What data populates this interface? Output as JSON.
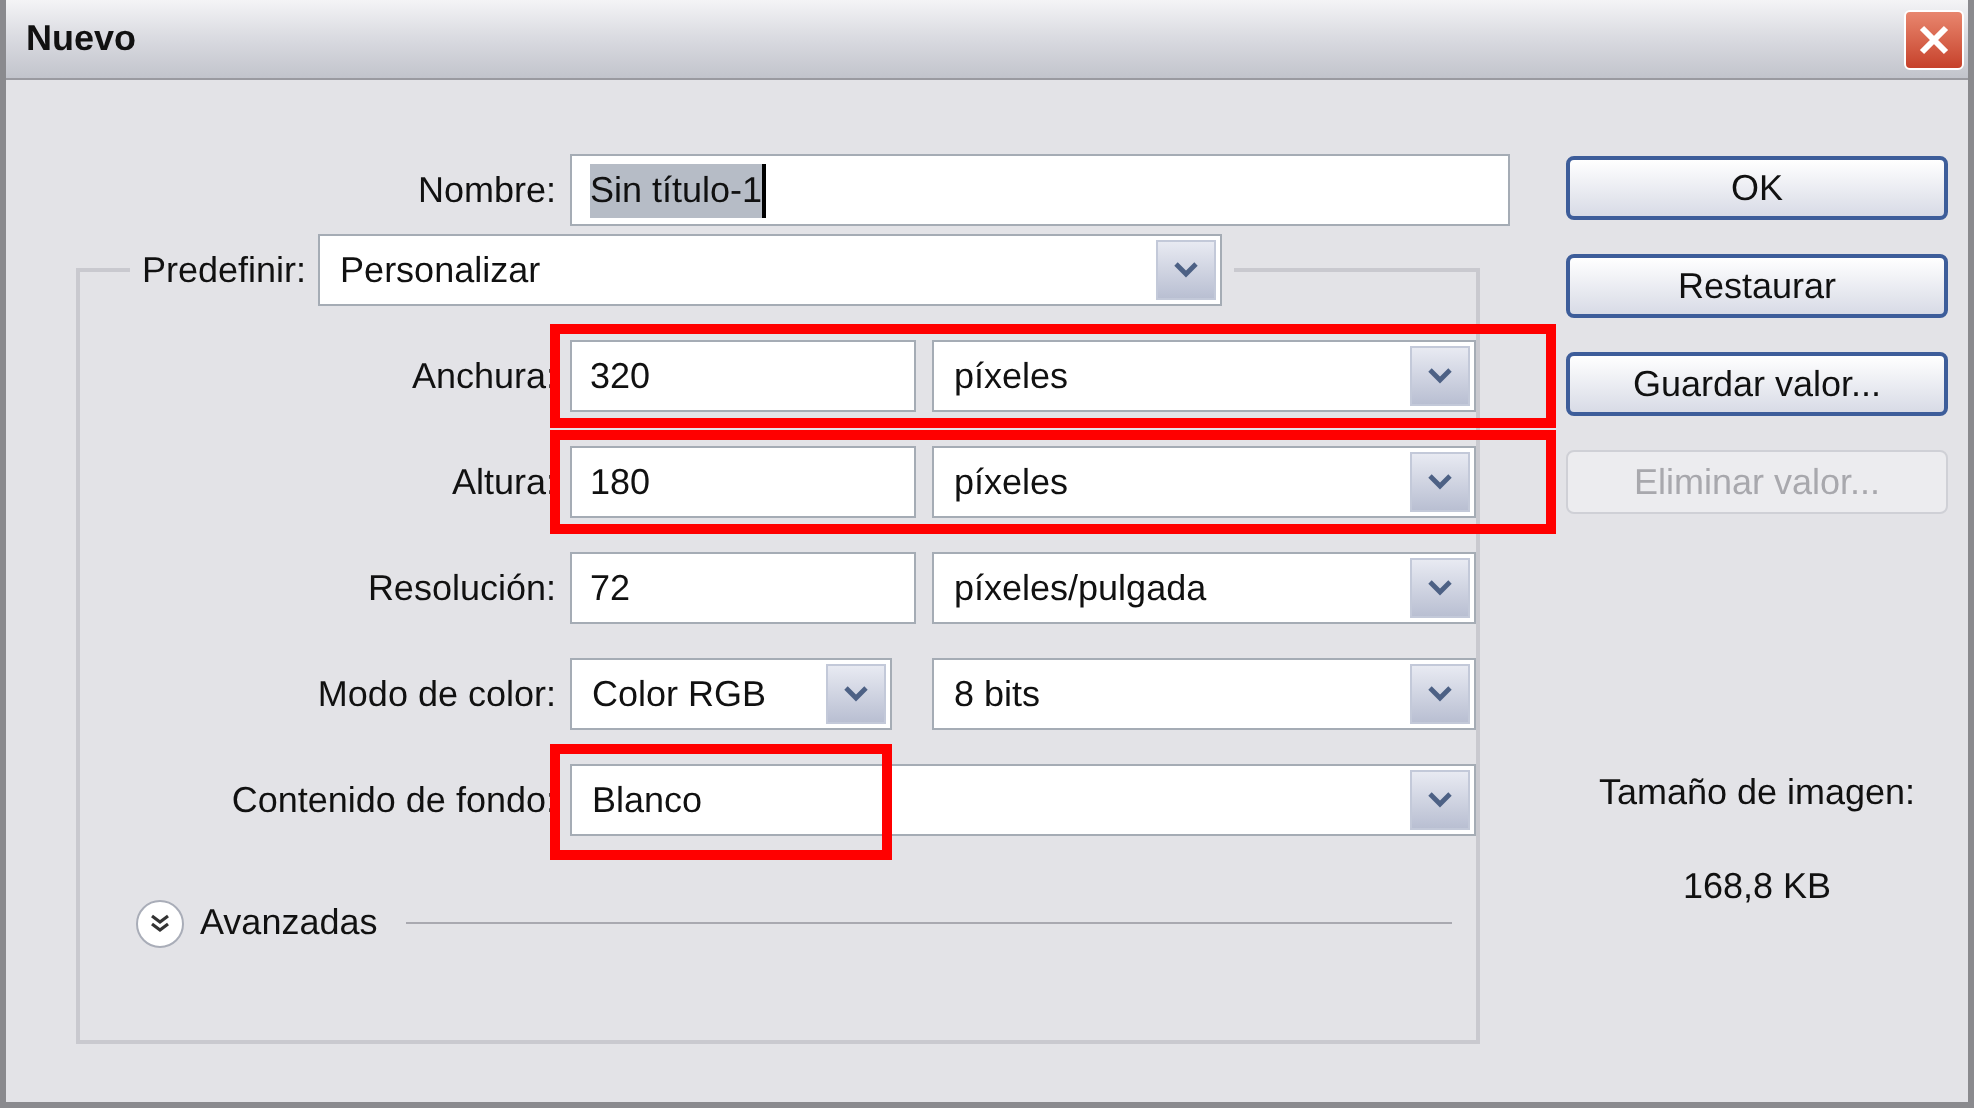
{
  "window": {
    "title": "Nuevo"
  },
  "name_field": {
    "label": "Nombre:",
    "value": "Sin título-1",
    "text_selected": true
  },
  "preset": {
    "label": "Predefinir:",
    "value": "Personalizar"
  },
  "rows": [
    {
      "kind": "value_unit",
      "label": "Anchura:",
      "value": "320",
      "unit": "píxeles",
      "highlighted": true
    },
    {
      "kind": "value_unit",
      "label": "Altura:",
      "value": "180",
      "unit": "píxeles",
      "highlighted": true
    },
    {
      "kind": "value_unit",
      "label": "Resolución:",
      "value": "72",
      "unit": "píxeles/pulgada"
    },
    {
      "kind": "two_selects",
      "label": "Modo de color:",
      "value": "Color RGB",
      "unit": "8 bits"
    },
    {
      "kind": "select",
      "label": "Contenido de fondo:",
      "value": "Blanco",
      "highlighted": true
    }
  ],
  "advanced": {
    "label": "Avanzadas",
    "expanded": false
  },
  "buttons": [
    {
      "label": "OK",
      "disabled": false
    },
    {
      "label": "Restaurar",
      "disabled": false
    },
    {
      "label": "Guardar valor...",
      "disabled": false
    },
    {
      "label": "Eliminar valor...",
      "disabled": true
    }
  ],
  "image_size": {
    "label": "Tamaño de imagen:",
    "value": "168,8 KB"
  }
}
